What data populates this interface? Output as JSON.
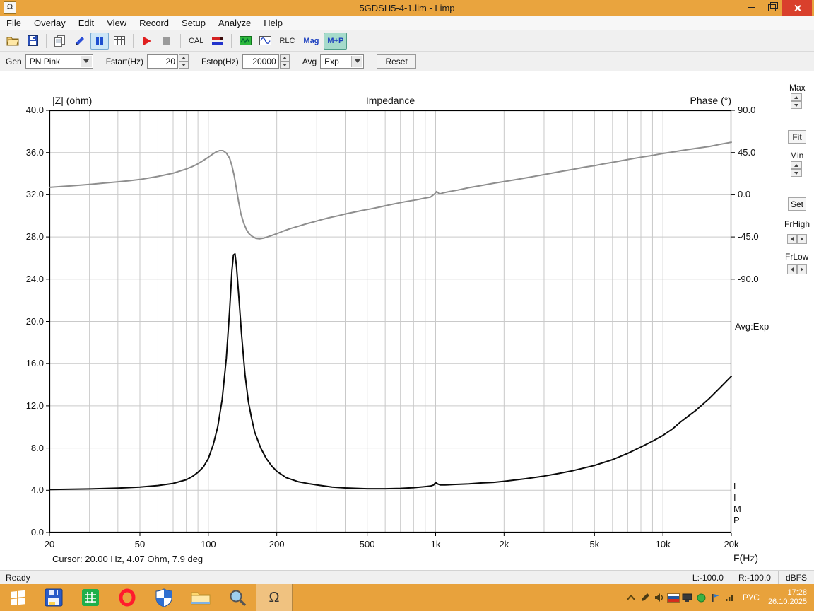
{
  "window": {
    "title": "5GDSH5-4-1.lim - Limp",
    "app_icon_glyph": "Ω"
  },
  "menu": {
    "items": [
      "File",
      "Overlay",
      "Edit",
      "View",
      "Record",
      "Setup",
      "Analyze",
      "Help"
    ]
  },
  "toolbar": {
    "cal_label": "CAL",
    "rlc_label": "RLC",
    "mag_label": "Mag",
    "mp_label": "M+P"
  },
  "controls": {
    "gen_label": "Gen",
    "gen_value": "PN Pink",
    "fstart_label": "Fstart(Hz)",
    "fstart_value": "20",
    "fstop_label": "Fstop(Hz)",
    "fstop_value": "20000",
    "avg_label": "Avg",
    "avg_value": "Exp",
    "reset_label": "Reset"
  },
  "chart": {
    "left_axis_title": "|Z| (ohm)",
    "title": "Impedance",
    "right_axis_title": "Phase (°)",
    "x_axis_title": "F(Hz)",
    "avg_text": "Avg:Exp",
    "limp_vertical": "LIMP",
    "cursor_text": "Cursor: 20.00 Hz, 4.07 Ohm, 7.9 deg"
  },
  "side_panel": {
    "max_label": "Max",
    "fit_label": "Fit",
    "min_label": "Min",
    "set_label": "Set",
    "frhigh_label": "FrHigh",
    "frlow_label": "FrLow"
  },
  "status": {
    "ready": "Ready",
    "l": "L:-100.0",
    "r": "R:-100.0",
    "unit": "dBFS"
  },
  "taskbar": {
    "lang": "РУС",
    "time": "17:28",
    "date": "26.10.2025",
    "icons": [
      "start",
      "floppy-app",
      "green-grid-app",
      "opera",
      "defender",
      "explorer",
      "search",
      "limp-omega"
    ],
    "tray_icons": [
      "hidden-icons-chevron",
      "stylus",
      "volume",
      "ru-flag",
      "display",
      "antivirus",
      "blue-flag",
      "network"
    ]
  },
  "chart_data": {
    "type": "line",
    "title": "Impedance",
    "xlabel": "F(Hz)",
    "x_scale": "log",
    "xlim": [
      20,
      20000
    ],
    "grid": true,
    "x_gridlines": [
      20,
      30,
      40,
      50,
      60,
      70,
      80,
      90,
      100,
      200,
      300,
      400,
      500,
      600,
      700,
      800,
      900,
      1000,
      2000,
      3000,
      4000,
      5000,
      6000,
      7000,
      8000,
      9000,
      10000,
      20000
    ],
    "x_ticks": [
      {
        "value": 20,
        "label": "20"
      },
      {
        "value": 50,
        "label": "50"
      },
      {
        "value": 100,
        "label": "100"
      },
      {
        "value": 200,
        "label": "200"
      },
      {
        "value": 500,
        "label": "500"
      },
      {
        "value": 1000,
        "label": "1k"
      },
      {
        "value": 2000,
        "label": "2k"
      },
      {
        "value": 5000,
        "label": "5k"
      },
      {
        "value": 10000,
        "label": "10k"
      },
      {
        "value": 20000,
        "label": "20k"
      }
    ],
    "left_axis": {
      "label": "|Z| (ohm)",
      "lim": [
        0,
        40
      ],
      "ticks": [
        {
          "value": 40,
          "label": "40.0"
        },
        {
          "value": 36,
          "label": "36.0"
        },
        {
          "value": 32,
          "label": "32.0"
        },
        {
          "value": 28,
          "label": "28.0"
        },
        {
          "value": 24,
          "label": "24.0"
        },
        {
          "value": 20,
          "label": "20.0"
        },
        {
          "value": 16,
          "label": "16.0"
        },
        {
          "value": 12,
          "label": "12.0"
        },
        {
          "value": 8,
          "label": "8.0"
        },
        {
          "value": 4,
          "label": "4.0"
        },
        {
          "value": 0,
          "label": "0.0"
        }
      ]
    },
    "right_axis": {
      "label": "Phase (°)",
      "deg0_at_ohm": 32,
      "ohm_per_45deg": 4,
      "ticks": [
        {
          "value": 90,
          "label": "90.0"
        },
        {
          "value": 45,
          "label": "45.0"
        },
        {
          "value": 0,
          "label": "0.0"
        },
        {
          "value": -45,
          "label": "-45.0"
        },
        {
          "value": -90,
          "label": "-90.0"
        }
      ]
    },
    "series": [
      {
        "name": "Impedance magnitude (ohm)",
        "axis": "left",
        "color": "#0a0a0a",
        "stroke_width": 2,
        "points": [
          [
            20,
            4.07
          ],
          [
            25,
            4.1
          ],
          [
            30,
            4.13
          ],
          [
            40,
            4.2
          ],
          [
            50,
            4.3
          ],
          [
            60,
            4.45
          ],
          [
            70,
            4.65
          ],
          [
            80,
            5.0
          ],
          [
            85,
            5.3
          ],
          [
            90,
            5.7
          ],
          [
            95,
            6.2
          ],
          [
            100,
            7.0
          ],
          [
            105,
            8.3
          ],
          [
            110,
            10.0
          ],
          [
            115,
            12.6
          ],
          [
            120,
            16.5
          ],
          [
            124,
            21.0
          ],
          [
            127,
            24.8
          ],
          [
            129,
            26.3
          ],
          [
            131,
            26.4
          ],
          [
            133,
            25.2
          ],
          [
            136,
            22.5
          ],
          [
            140,
            18.8
          ],
          [
            145,
            15.0
          ],
          [
            150,
            12.4
          ],
          [
            155,
            10.8
          ],
          [
            160,
            9.5
          ],
          [
            170,
            8.0
          ],
          [
            180,
            7.0
          ],
          [
            190,
            6.3
          ],
          [
            200,
            5.8
          ],
          [
            220,
            5.2
          ],
          [
            250,
            4.8
          ],
          [
            280,
            4.6
          ],
          [
            300,
            4.5
          ],
          [
            350,
            4.3
          ],
          [
            400,
            4.22
          ],
          [
            450,
            4.18
          ],
          [
            500,
            4.15
          ],
          [
            600,
            4.15
          ],
          [
            700,
            4.18
          ],
          [
            800,
            4.25
          ],
          [
            900,
            4.35
          ],
          [
            950,
            4.4
          ],
          [
            980,
            4.5
          ],
          [
            1000,
            4.75
          ],
          [
            1020,
            4.6
          ],
          [
            1050,
            4.5
          ],
          [
            1100,
            4.5
          ],
          [
            1200,
            4.55
          ],
          [
            1400,
            4.6
          ],
          [
            1600,
            4.7
          ],
          [
            1800,
            4.75
          ],
          [
            2000,
            4.85
          ],
          [
            2500,
            5.1
          ],
          [
            3000,
            5.35
          ],
          [
            3500,
            5.6
          ],
          [
            4000,
            5.85
          ],
          [
            5000,
            6.35
          ],
          [
            6000,
            6.9
          ],
          [
            7000,
            7.5
          ],
          [
            8000,
            8.1
          ],
          [
            9000,
            8.65
          ],
          [
            10000,
            9.2
          ],
          [
            11000,
            9.8
          ],
          [
            12000,
            10.5
          ],
          [
            14000,
            11.6
          ],
          [
            16000,
            12.7
          ],
          [
            18000,
            13.8
          ],
          [
            20000,
            14.8
          ]
        ]
      },
      {
        "name": "Phase (deg)",
        "axis": "right",
        "color": "#8e8e8e",
        "stroke_width": 2,
        "points": [
          [
            20,
            7.9
          ],
          [
            25,
            9.5
          ],
          [
            30,
            11
          ],
          [
            35,
            12.5
          ],
          [
            40,
            13.8
          ],
          [
            45,
            15
          ],
          [
            50,
            16.3
          ],
          [
            60,
            19.5
          ],
          [
            70,
            23
          ],
          [
            80,
            27.5
          ],
          [
            85,
            30
          ],
          [
            90,
            33
          ],
          [
            95,
            36.5
          ],
          [
            100,
            40
          ],
          [
            104,
            43
          ],
          [
            108,
            45.5
          ],
          [
            112,
            47
          ],
          [
            116,
            47
          ],
          [
            120,
            44.5
          ],
          [
            124,
            39
          ],
          [
            127,
            31
          ],
          [
            130,
            20
          ],
          [
            133,
            6
          ],
          [
            136,
            -8
          ],
          [
            139,
            -20
          ],
          [
            143,
            -30
          ],
          [
            147,
            -37
          ],
          [
            151,
            -41.5
          ],
          [
            156,
            -44.5
          ],
          [
            162,
            -46.5
          ],
          [
            168,
            -47
          ],
          [
            175,
            -46.3
          ],
          [
            182,
            -45
          ],
          [
            190,
            -43.5
          ],
          [
            200,
            -41.5
          ],
          [
            215,
            -38.5
          ],
          [
            230,
            -36
          ],
          [
            250,
            -33.5
          ],
          [
            270,
            -31
          ],
          [
            290,
            -29
          ],
          [
            310,
            -27
          ],
          [
            340,
            -24.5
          ],
          [
            370,
            -22.5
          ],
          [
            400,
            -20.5
          ],
          [
            440,
            -18.5
          ],
          [
            480,
            -16.5
          ],
          [
            520,
            -15
          ],
          [
            570,
            -13
          ],
          [
            620,
            -11
          ],
          [
            680,
            -9
          ],
          [
            750,
            -7
          ],
          [
            820,
            -5.5
          ],
          [
            900,
            -3.5
          ],
          [
            950,
            -2.5
          ],
          [
            990,
            1
          ],
          [
            1010,
            3.5
          ],
          [
            1040,
            0.8
          ],
          [
            1080,
            2
          ],
          [
            1150,
            3.5
          ],
          [
            1250,
            5
          ],
          [
            1400,
            7.5
          ],
          [
            1600,
            10
          ],
          [
            1800,
            12.3
          ],
          [
            2000,
            14
          ],
          [
            2300,
            16.5
          ],
          [
            2600,
            18.8
          ],
          [
            3000,
            21.5
          ],
          [
            3500,
            24.5
          ],
          [
            4000,
            27
          ],
          [
            4500,
            29.3
          ],
          [
            5000,
            31
          ],
          [
            5500,
            33
          ],
          [
            6000,
            34.5
          ],
          [
            7000,
            37.5
          ],
          [
            8000,
            40
          ],
          [
            9000,
            42
          ],
          [
            10000,
            44
          ],
          [
            11000,
            45.5
          ],
          [
            12000,
            47
          ],
          [
            14000,
            49.5
          ],
          [
            16000,
            51.5
          ],
          [
            18000,
            54
          ],
          [
            20000,
            56
          ]
        ]
      }
    ],
    "cursor_readout": {
      "frequency_hz": 20.0,
      "impedance_ohm": 4.07,
      "phase_deg": 7.9
    },
    "legend_position": "none"
  }
}
